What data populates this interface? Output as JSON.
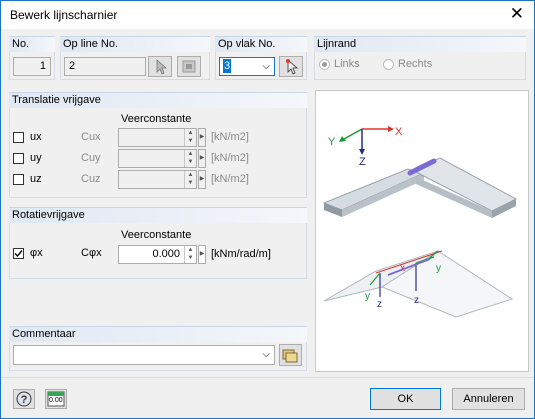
{
  "window": {
    "title": "Bewerk lijnscharnier"
  },
  "no": {
    "label": "No.",
    "value": "1"
  },
  "op_line": {
    "label": "Op line No.",
    "value": "2"
  },
  "op_vlak": {
    "label": "Op vlak No.",
    "value": "3"
  },
  "lijnrand": {
    "label": "Lijnrand",
    "options": [
      "Links",
      "Rechts"
    ],
    "selected": "Links"
  },
  "translatie": {
    "label": "Translatie vrijgave",
    "subheader": "Veerconstante",
    "rows": [
      {
        "dof": "ux",
        "const": "Cux",
        "unit": "[kN/m2]",
        "checked": false
      },
      {
        "dof": "uy",
        "const": "Cuy",
        "unit": "[kN/m2]",
        "checked": false
      },
      {
        "dof": "uz",
        "const": "Cuz",
        "unit": "[kN/m2]",
        "checked": false
      }
    ]
  },
  "rotatie": {
    "label": "Rotatievrijgave",
    "subheader": "Veerconstante",
    "row": {
      "dof": "φx",
      "const": "Cφx",
      "value": "0.000",
      "unit": "[kNm/rad/m]",
      "checked": true
    }
  },
  "commentaar": {
    "label": "Commentaar",
    "value": ""
  },
  "preview": {
    "axes_top": {
      "x": "X",
      "y": "Y",
      "z": "Z"
    },
    "axes_bottom": {
      "x": "x",
      "y": "y",
      "z": "z"
    }
  },
  "footer": {
    "ok": "OK",
    "cancel": "Annuleren",
    "units_badge": "0.00"
  },
  "colors": {
    "accent": "#1a73c6",
    "hinge": "#7d6bd4",
    "x_axis": "#e0332b",
    "y_axis": "#1a9a3a",
    "z_axis": "#2a2a8a"
  }
}
